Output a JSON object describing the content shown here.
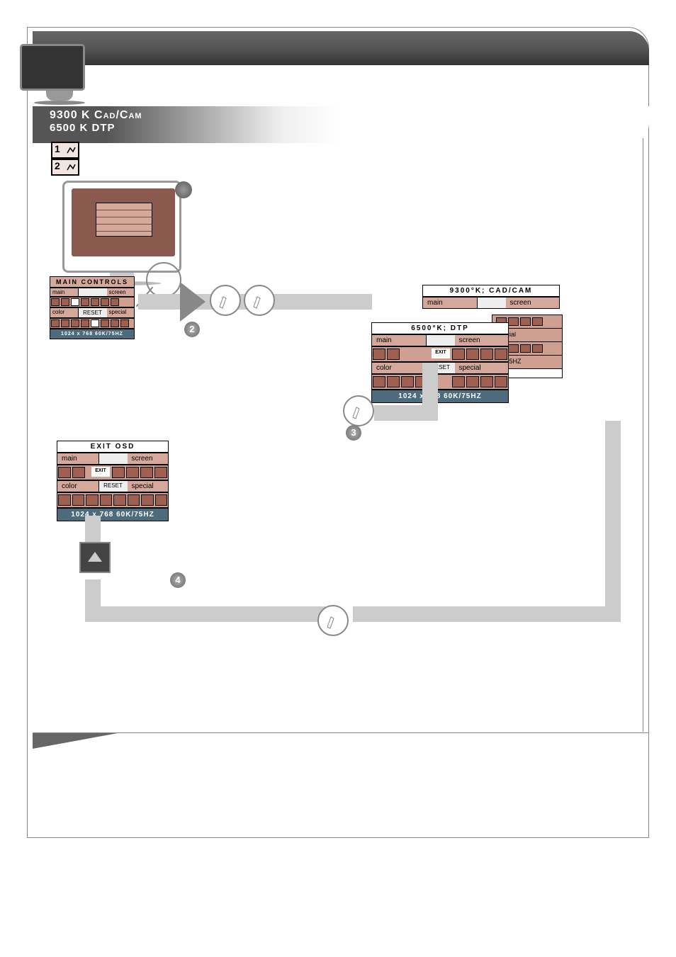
{
  "title_line1_a": "9300 K ",
  "title_line1_b": "Cad/Cam",
  "title_line2": "6500 K DTP",
  "btn1": "1",
  "btn2": "2",
  "osd_main": {
    "title": "MAIN CONTROLS",
    "tab_main": "main",
    "tab_screen": "screen",
    "tab_color": "color",
    "reset": "RESET",
    "tab_special": "special",
    "status": "1024 x 768  60K/75HZ"
  },
  "osd_9300": {
    "title": "9300°K; CAD/CAM",
    "main": "main",
    "screen": "screen"
  },
  "osd_6500": {
    "title": "6500°K; DTP",
    "main": "main",
    "screen": "screen",
    "exit": "EXIT",
    "color": "color",
    "reset": "RESET",
    "special": "special",
    "status": "1024 x 768  60K/75HZ"
  },
  "cascade": {
    "r2": "special",
    "r3": "K / 75HZ"
  },
  "osd_exit": {
    "title": "EXIT OSD",
    "main": "main",
    "screen": "screen",
    "exit": "EXIT",
    "color": "color",
    "reset": "RESET",
    "special": "special",
    "status": "1024 x 768  60K/75HZ"
  },
  "badges": {
    "b2": "2",
    "b3": "3",
    "b4": "4"
  }
}
